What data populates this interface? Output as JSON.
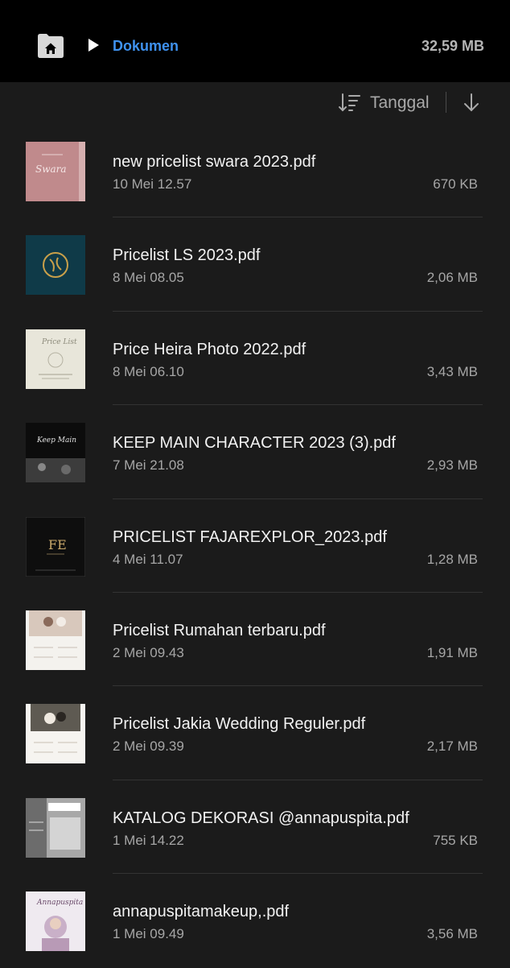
{
  "breadcrumb": {
    "home_icon": "home-icon",
    "separator_icon": "chevron-right-icon",
    "current": "Dokumen"
  },
  "storage_total": "32,59 MB",
  "sort": {
    "icon": "sort-lines-icon",
    "label": "Tanggal",
    "direction_icon": "arrow-down-icon"
  },
  "files": [
    {
      "name": "new pricelist swara 2023.pdf",
      "date": "10 Mei 12.57",
      "size": "670 KB",
      "thumb": "pink-cover"
    },
    {
      "name": "Pricelist LS 2023.pdf",
      "date": "8 Mei 08.05",
      "size": "2,06 MB",
      "thumb": "teal-logo"
    },
    {
      "name": "Price Heira Photo 2022.pdf",
      "date": "8 Mei 06.10",
      "size": "3,43 MB",
      "thumb": "cream-card"
    },
    {
      "name": "KEEP MAIN CHARACTER 2023 (3).pdf",
      "date": "7 Mei 21.08",
      "size": "2,93 MB",
      "thumb": "dark-photo"
    },
    {
      "name": "PRICELIST FAJAREXPLOR_2023.pdf",
      "date": "4 Mei 11.07",
      "size": "1,28 MB",
      "thumb": "black-monogram"
    },
    {
      "name": "Pricelist Rumahan terbaru.pdf",
      "date": "2 Mei 09.43",
      "size": "1,91 MB",
      "thumb": "wedding-photo"
    },
    {
      "name": "Pricelist Jakia Wedding Reguler.pdf",
      "date": "2 Mei 09.39",
      "size": "2,17 MB",
      "thumb": "wedding-photo-2"
    },
    {
      "name": "KATALOG DEKORASI @annapuspita.pdf",
      "date": "1 Mei 14.22",
      "size": "755 KB",
      "thumb": "grey-catalog"
    },
    {
      "name": "annapuspitamakeup,.pdf",
      "date": "1 Mei 09.49",
      "size": "3,56 MB",
      "thumb": "bride-portrait"
    }
  ],
  "colors": {
    "background": "#1b1b1b",
    "topbar": "#000000",
    "accent": "#3f92f0",
    "secondary_text": "#a6a6a6"
  }
}
